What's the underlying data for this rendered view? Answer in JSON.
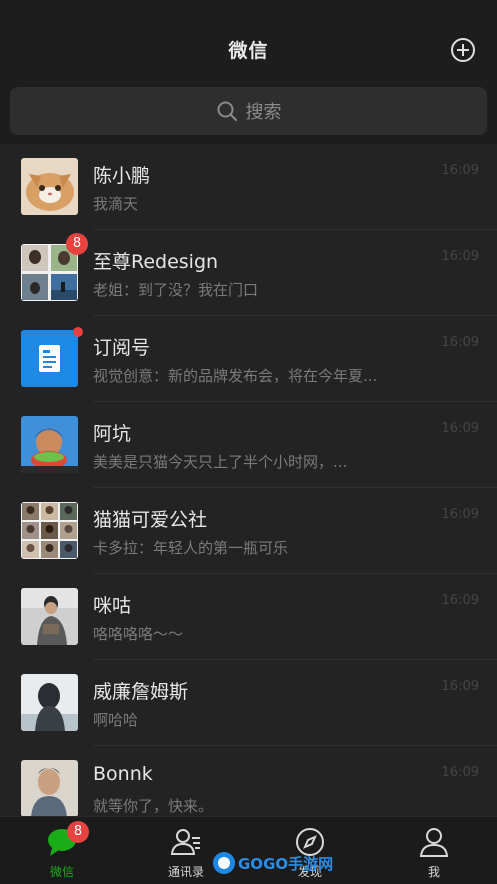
{
  "header": {
    "title": "微信"
  },
  "search": {
    "placeholder": "搜索"
  },
  "chats": [
    {
      "name": "陈小鹏",
      "preview": "我滴天",
      "time": "16:09"
    },
    {
      "name": "至尊Redesign",
      "preview": "老姐：到了没？我在门口",
      "time": "16:09",
      "badge": "8"
    },
    {
      "name": "订阅号",
      "preview": "视觉创意：新的品牌发布会，将在今年夏...",
      "time": "16:09"
    },
    {
      "name": "阿坑",
      "preview": "美美是只猫今天只上了半个小时网，...",
      "time": "16:09"
    },
    {
      "name": "猫猫可爱公社",
      "preview": "卡多拉：年轻人的第一瓶可乐",
      "time": "16:09"
    },
    {
      "name": "咪咕",
      "preview": "咯咯咯咯～～",
      "time": "16:09"
    },
    {
      "name": "威廉詹姆斯",
      "preview": "啊哈哈",
      "time": "16:09"
    },
    {
      "name": "Bonnk",
      "preview": "就等你了，快来。",
      "time": "16:09"
    }
  ],
  "tabbar": {
    "tabs": [
      {
        "label": "微信",
        "badge": "8",
        "active": true
      },
      {
        "label": "通讯录"
      },
      {
        "label": "发现"
      },
      {
        "label": "我"
      }
    ]
  },
  "watermark": {
    "text": "GOGO手游网"
  },
  "colors": {
    "accent": "#1aad19",
    "badge": "#e64340",
    "background": "#1b1b1b",
    "list_background": "#232323"
  }
}
